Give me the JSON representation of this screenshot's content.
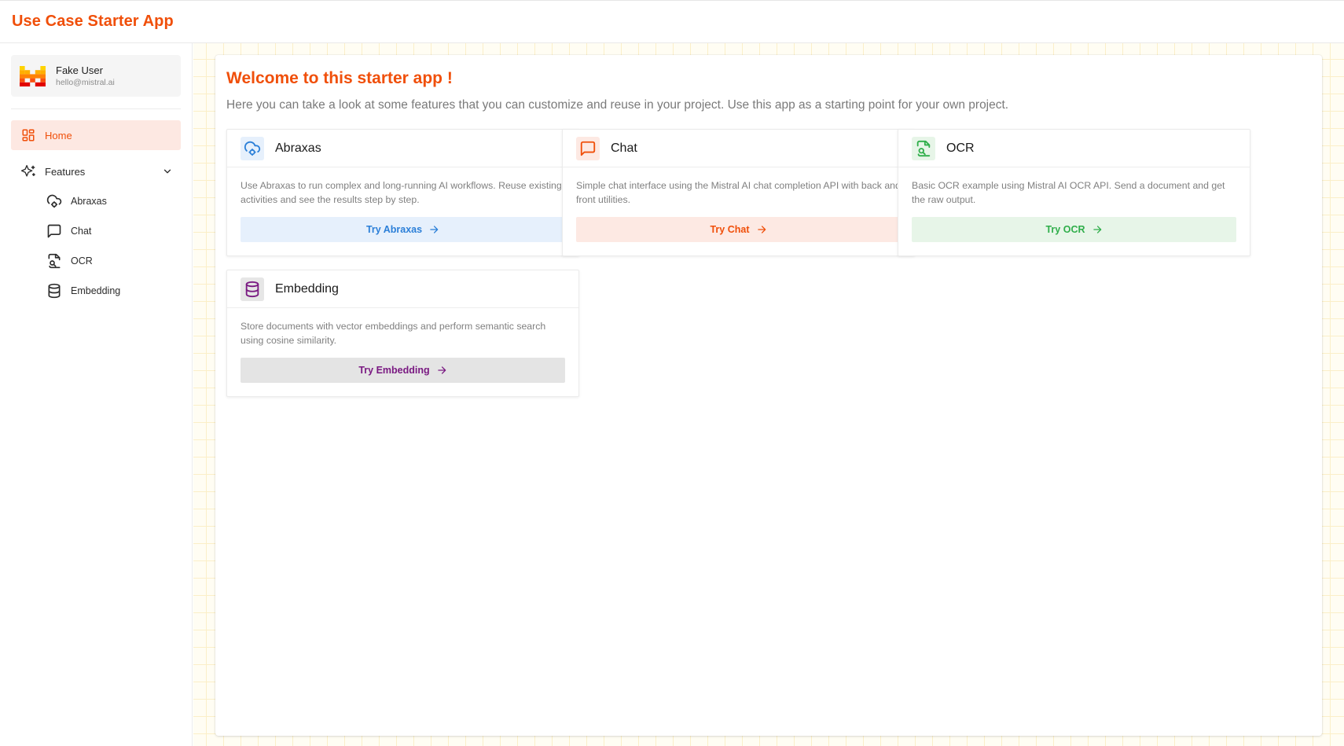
{
  "app": {
    "title": "Use Case Starter App"
  },
  "user": {
    "name": "Fake User",
    "email": "hello@mistral.ai"
  },
  "sidebar": {
    "home_label": "Home",
    "features_label": "Features",
    "sub_items": [
      {
        "label": "Abraxas",
        "icon": "cloud-cog-icon"
      },
      {
        "label": "Chat",
        "icon": "message-square-icon"
      },
      {
        "label": "OCR",
        "icon": "file-scan-icon"
      },
      {
        "label": "Embedding",
        "icon": "database-icon"
      }
    ]
  },
  "main": {
    "title": "Welcome to this starter app !",
    "subtitle": "Here you can take a look at some features that you can customize and reuse in your project. Use this app as a starting point for your own project.",
    "cards": [
      {
        "title": "Abraxas",
        "description": "Use Abraxas to run complex and long-running AI workflows. Reuse existing activities and see the results step by step.",
        "button": "Try Abraxas",
        "accent": "#2b7fd8",
        "button_bg": "#e6f0fc"
      },
      {
        "title": "Chat",
        "description": "Simple chat interface using the Mistral AI chat completion API with back and front utilities.",
        "button": "Try Chat",
        "accent": "#f04f0a",
        "button_bg": "#fde9e3"
      },
      {
        "title": "OCR",
        "description": "Basic OCR example using Mistral AI OCR API. Send a document and get the raw output.",
        "button": "Try OCR",
        "accent": "#2fae4a",
        "button_bg": "#e7f5e8"
      },
      {
        "title": "Embedding",
        "description": "Store documents with vector embeddings and perform semantic search using cosine similarity.",
        "button": "Try Embedding",
        "accent": "#7a1a82",
        "button_bg": "#e4e4e4"
      }
    ]
  }
}
